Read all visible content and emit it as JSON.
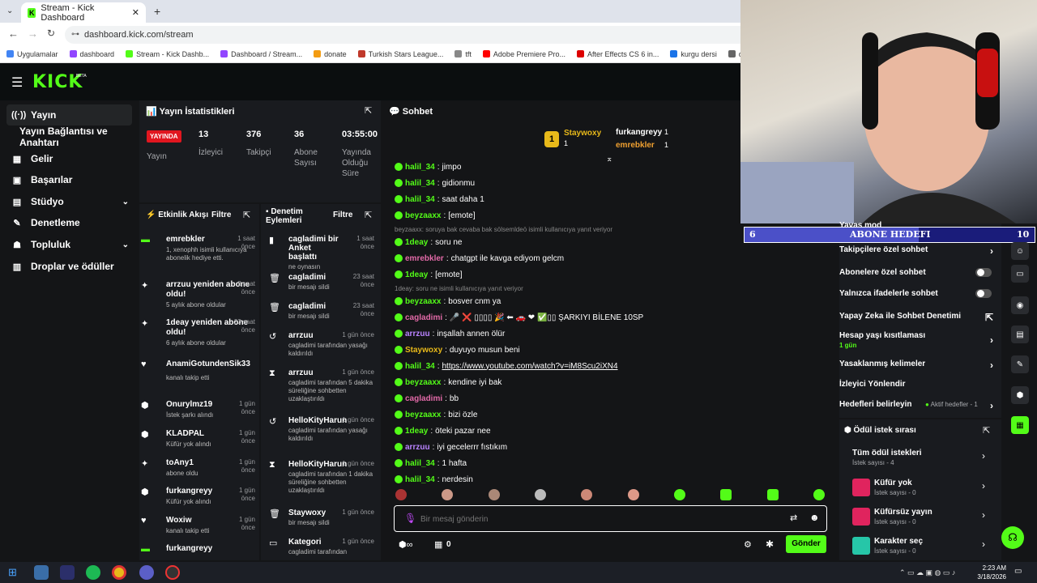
{
  "browser": {
    "tab_title": "Stream - Kick Dashboard",
    "url": "dashboard.kick.com/stream",
    "bookmarks": [
      "Uygulamalar",
      "dashboard",
      "Stream - Kick Dashb...",
      "Dashboard / Stream...",
      "donate",
      "Turkish Stars League...",
      "tft",
      "Adobe Premiere Pro...",
      "After Effects CS 6 in...",
      "kurgu dersi",
      "darko",
      "coinn"
    ]
  },
  "app": {
    "logo": "KICK",
    "beta": "BETA"
  },
  "sidebar": {
    "items": [
      {
        "icon": "((·))",
        "label": "Yayın"
      },
      {
        "icon": "",
        "label": "Yayın Bağlantısı ve Anahtarı"
      },
      {
        "icon": "▦",
        "label": "Gelir"
      },
      {
        "icon": "▣",
        "label": "Başarılar"
      },
      {
        "icon": "▤",
        "label": "Stüdyo"
      },
      {
        "icon": "✎",
        "label": "Denetleme"
      },
      {
        "icon": "☗",
        "label": "Topluluk"
      },
      {
        "icon": "▥",
        "label": "Droplar ve ödüller"
      }
    ]
  },
  "stats": {
    "title": "Yayın İstatistikleri",
    "live_badge": "YAYINDA",
    "live_label": "Yayın",
    "viewers": {
      "value": "13",
      "label": "İzleyici"
    },
    "followers": {
      "value": "376",
      "label": "Takipçi"
    },
    "subs": {
      "value": "36",
      "label": "Abone Sayısı"
    },
    "uptime": {
      "value": "03:55:00",
      "label": "Yayında Olduğu Süre"
    }
  },
  "activity": {
    "title": "Etkinlik Akışı",
    "filter": "Filtre",
    "items": [
      {
        "name": "emrebkler",
        "time": "1 saat önce",
        "desc": "1, xenophh isimli kullanıcıya abonelik hediye etti."
      },
      {
        "name": "arrzuu yeniden abone oldu!",
        "time": "2 saat önce",
        "desc": "5 aylık abone oldular"
      },
      {
        "name": "1deay yeniden abone oldu!",
        "time": "23 saat önce",
        "desc": "6 aylık abone oldular"
      },
      {
        "name": "AnamiGotundenSik33",
        "time": "1 gün önce",
        "desc": "kanalı takip etti"
      },
      {
        "name": "Onurylmz19",
        "time": "1 gün önce",
        "desc": "İstek şarkı alındı"
      },
      {
        "name": "KLADPAL",
        "time": "1 gün önce",
        "desc": "Küfür yok alındı"
      },
      {
        "name": "toAny1",
        "time": "1 gün önce",
        "desc": "abone oldu"
      },
      {
        "name": "furkangreyy",
        "time": "1 gün önce",
        "desc": "Küfür yok alındı"
      },
      {
        "name": "Woxiw",
        "time": "1 gün önce",
        "desc": "kanalı takip etti"
      },
      {
        "name": "furkangreyy",
        "time": "1 gün önce",
        "desc": ""
      }
    ]
  },
  "moderation": {
    "title": "Denetim Eylemleri",
    "filter": "Filtre",
    "items": [
      {
        "name": "cagladimi bir Anket başlattı",
        "time": "1 saat önce",
        "desc": "ne oynasın"
      },
      {
        "name": "cagladimi",
        "time": "23 saat önce",
        "desc": "bir mesajı sildi"
      },
      {
        "name": "cagladimi",
        "time": "23 saat önce",
        "desc": "bir mesajı sildi"
      },
      {
        "name": "arrzuu",
        "time": "1 gün önce",
        "desc": "cagladimi tarafından yasağı kaldırıldı"
      },
      {
        "name": "arrzuu",
        "time": "1 gün önce",
        "desc": "cagladimi tarafından 5 dakika süreliğine sohbetten uzaklaştırıldı"
      },
      {
        "name": "HelloKityHarun",
        "time": "1 gün önce",
        "desc": "cagladimi tarafından yasağı kaldırıldı"
      },
      {
        "name": "HelloKityHarun",
        "time": "1 gün önce",
        "desc": "cagladimi tarafından 1 dakika süreliğine sohbetten uzaklaştırıldı"
      },
      {
        "name": "Staywoxy",
        "time": "1 gün önce",
        "desc": "bir mesajı sildi"
      },
      {
        "name": "Kategori",
        "time": "1 gün önce",
        "desc": "cagladimi tarafından"
      }
    ]
  },
  "chat": {
    "title": "Sohbet",
    "top": [
      {
        "name": "Staywoxy",
        "count": "1"
      },
      {
        "name": "furkangreyy",
        "count": "1"
      },
      {
        "name": "emrebkler",
        "count": "1"
      }
    ],
    "messages": [
      {
        "user": "halil_34",
        "color": "#53fc18",
        "text": "jimpo"
      },
      {
        "user": "halil_34",
        "color": "#53fc18",
        "text": "gidionmu"
      },
      {
        "user": "halil_34",
        "color": "#53fc18",
        "text": "saat daha 1"
      },
      {
        "user": "beyzaaxx",
        "color": "#53fc18",
        "text": "[emote]"
      },
      {
        "user": "",
        "color": "#888",
        "text": "beyzaaxx: soruya bak cevaba bak sölsemldeö isimli kullanıcıya yanıt veriyor"
      },
      {
        "user": "1deay",
        "color": "#53fc18",
        "text": "soru ne"
      },
      {
        "user": "emrebkler",
        "color": "#e36aa8",
        "text": "chatgpt ile kavga ediyom gelcm"
      },
      {
        "user": "1deay",
        "color": "#53fc18",
        "text": "[emote]"
      },
      {
        "user": "",
        "color": "#888",
        "text": "1deay: soru ne isimli kullanıcıya yanıt veriyor"
      },
      {
        "user": "beyzaaxx",
        "color": "#53fc18",
        "text": "bosver cnm ya"
      },
      {
        "user": "cagladimi",
        "color": "#e36aa8",
        "text": "🎤 ❌ ▯▯▯▯ 🎉 ⬅ 🚗 ❤ ✅▯▯ ŞARKIYI BİLENE 10SP"
      },
      {
        "user": "arrzuu",
        "color": "#b983ff",
        "text": "inşallah annen ölür"
      },
      {
        "user": "Staywoxy",
        "color": "#e8b91a",
        "text": "duyuyo musun beni"
      },
      {
        "user": "halil_34",
        "color": "#53fc18",
        "text": "https://www.youtube.com/watch?v=iM8Scu2iXN4"
      },
      {
        "user": "beyzaaxx",
        "color": "#53fc18",
        "text": "kendine iyi bak"
      },
      {
        "user": "cagladimi",
        "color": "#e36aa8",
        "text": "bb"
      },
      {
        "user": "beyzaaxx",
        "color": "#53fc18",
        "text": "bizi özle"
      },
      {
        "user": "1deay",
        "color": "#53fc18",
        "text": "öteki pazar nee"
      },
      {
        "user": "arrzuu",
        "color": "#b983ff",
        "text": "iyi gecelerrr fıstıkım"
      },
      {
        "user": "halil_34",
        "color": "#53fc18",
        "text": "1 hafta"
      },
      {
        "user": "halil_34",
        "color": "#53fc18",
        "text": "nerdesin"
      }
    ],
    "placeholder": "Bir mesaj gönderin",
    "points": "0",
    "send": "Gönder"
  },
  "settings": {
    "items": [
      {
        "label": "Yavaş mod",
        "type": "chev"
      },
      {
        "label": "Takipçilere özel sohbet",
        "type": "chev"
      },
      {
        "label": "Abonelere özel sohbet",
        "type": "toggle"
      },
      {
        "label": "Yalnızca ifadelerle sohbet",
        "type": "toggle"
      },
      {
        "label": "Yapay Zeka ile Sohbet Denetimi",
        "type": "ext"
      },
      {
        "label": "Hesap yaşı kısıtlaması",
        "sub": "1 gün",
        "type": "chev"
      },
      {
        "label": "Yasaklanmış kelimeler",
        "type": "chev"
      },
      {
        "label": "İzleyici Yönlendir",
        "type": "none"
      },
      {
        "label": "Hedefleri belirleyin",
        "sub_inline": "Aktif hedefler - 1",
        "type": "chev"
      }
    ]
  },
  "goal": {
    "left": "6",
    "title": "ABONE HEDEFI",
    "right": "10",
    "progress": 0.6
  },
  "rewards": {
    "title": "Ödül istek sırası",
    "all": {
      "label": "Tüm ödül istekleri",
      "sub": "İstek sayısı - 4"
    },
    "items": [
      {
        "label": "Küfür yok",
        "sub": "İstek sayısı - 0",
        "color": "#e0245e"
      },
      {
        "label": "Küfürsüz yayın",
        "sub": "İstek sayısı - 0",
        "color": "#e0245e"
      },
      {
        "label": "Karakter seç",
        "sub": "İstek sayısı - 0",
        "color": "#26c6a8"
      }
    ]
  },
  "taskbar": {
    "time": "2:23 AM",
    "date": "3/18/2026"
  }
}
